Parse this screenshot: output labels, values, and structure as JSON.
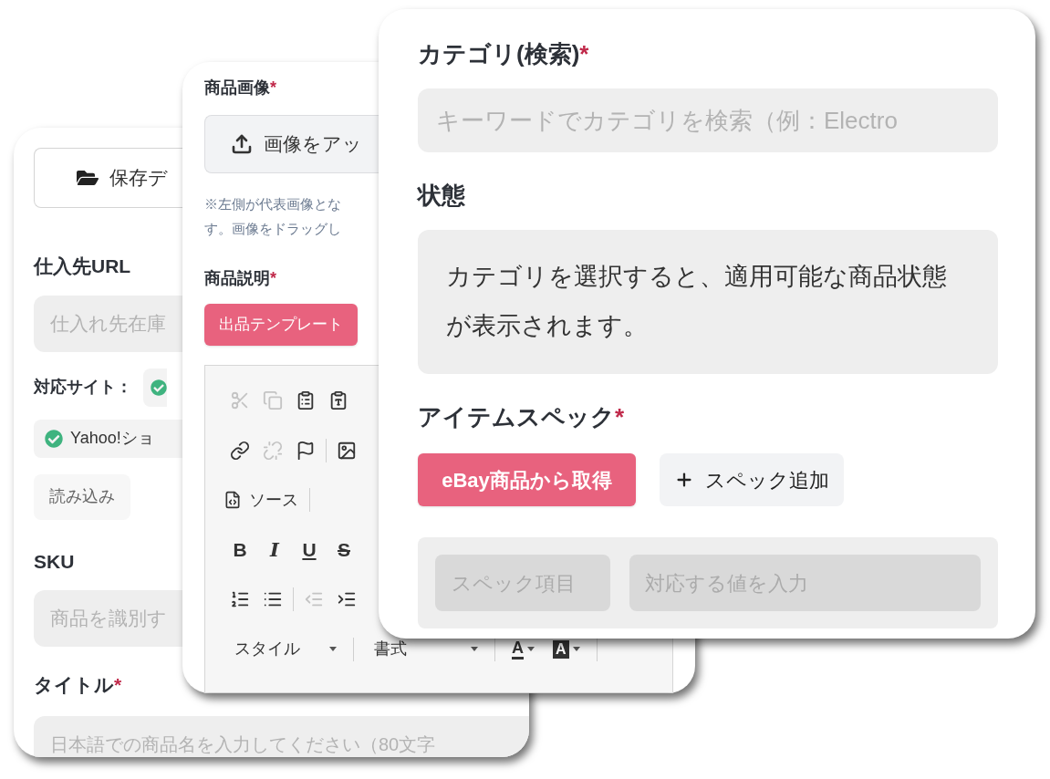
{
  "left_card": {
    "load_saved_button": {
      "label": "保存デ"
    },
    "supplier_url": {
      "label": "仕入先URL",
      "placeholder": "仕入れ先在庫"
    },
    "supported_sites": {
      "label": "対応サイト：",
      "chips": [
        {
          "checked": true
        },
        {
          "label": "Yahoo!ショ",
          "checked": true
        }
      ]
    },
    "load_button": {
      "label": "読み込み"
    },
    "sku": {
      "label": "SKU",
      "placeholder": "商品を識別す"
    },
    "title": {
      "label": "タイトル",
      "required_mark": "*",
      "placeholder": "日本語での商品名を入力してください（80文字"
    }
  },
  "middle_card": {
    "images": {
      "label": "商品画像",
      "required_mark": "*",
      "upload_button": "画像をアッ",
      "note": [
        "※左側が代表画像とな",
        "す。画像をドラッグし"
      ]
    },
    "description": {
      "label": "商品説明",
      "required_mark": "*",
      "template_button": "出品テンプレート",
      "toolbar": {
        "clipboard": [
          {
            "disabled": true
          },
          {
            "disabled": true
          },
          {
            "disabled": false
          },
          {
            "disabled": false
          }
        ],
        "links": [
          {
            "disabled": false
          },
          {
            "disabled": true
          },
          {
            "disabled": false
          }
        ],
        "image": {
          "disabled": false
        },
        "source": {
          "label": "ソース"
        },
        "formats": [
          {
            "kind": "bold",
            "label": "B"
          },
          {
            "kind": "italic",
            "label": "I"
          },
          {
            "kind": "underline",
            "label": "U"
          },
          {
            "kind": "strike",
            "label": "S"
          }
        ],
        "lists": [
          {
            "disabled": false
          },
          {
            "disabled": false
          }
        ],
        "indent": [
          {
            "disabled": true
          },
          {
            "disabled": false
          }
        ],
        "dropdowns": [
          {
            "label": "スタイル"
          },
          {
            "label": "書式"
          }
        ],
        "colors": [
          {
            "kind": "text",
            "label": "A"
          },
          {
            "kind": "background",
            "label": "A"
          }
        ]
      }
    }
  },
  "right_card": {
    "category": {
      "label": "カテゴリ(検索)",
      "required_mark": "*",
      "placeholder": "キーワードでカテゴリを検索（例：Electro"
    },
    "condition": {
      "label": "状態",
      "message": "カテゴリを選択すると、適用可能な商品状態が表示されます。"
    },
    "item_specs": {
      "label": "アイテムスペック",
      "required_mark": "*",
      "fetch_button": "eBay商品から取得",
      "add_button": "スペック追加",
      "row": {
        "name_placeholder": "スペック項目",
        "value_placeholder": "対応する値を入力"
      }
    }
  }
}
